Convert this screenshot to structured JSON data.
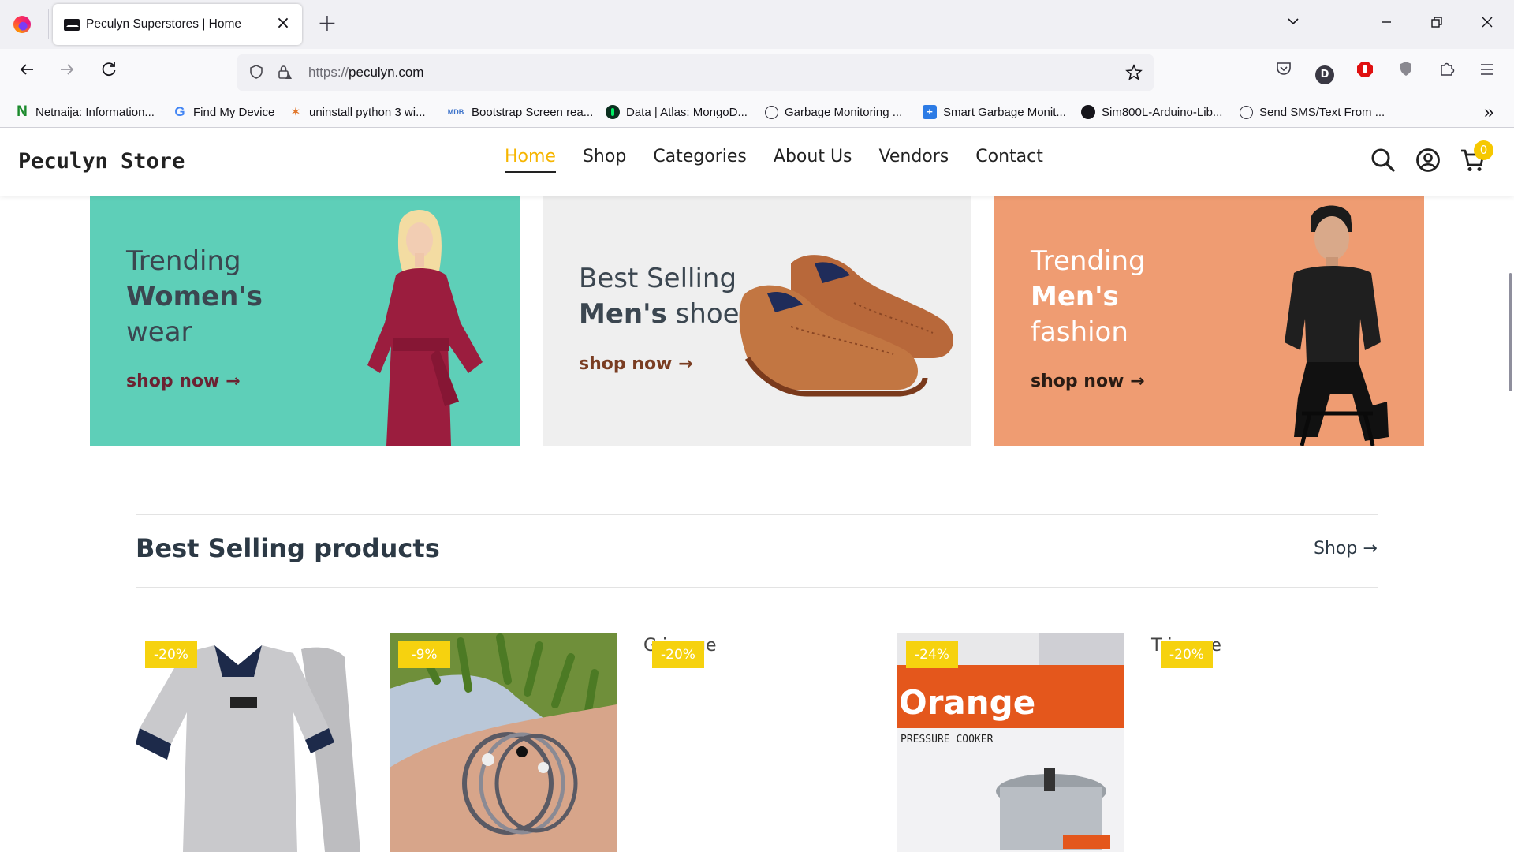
{
  "browser": {
    "tab_title": "Peculyn Superstores | Home",
    "url_scheme": "https://",
    "url_host": "peculyn.com",
    "bookmarks": [
      {
        "label": "Netnaija: Information...",
        "icon": "netnaija-icon"
      },
      {
        "label": "Find My Device",
        "icon": "google-icon"
      },
      {
        "label": "uninstall python 3 wi...",
        "icon": "bookmark-icon"
      },
      {
        "label": "Bootstrap Screen rea...",
        "icon": "mdb-icon"
      },
      {
        "label": "Data | Atlas: MongoD...",
        "icon": "mongodb-icon"
      },
      {
        "label": "Garbage Monitoring ...",
        "icon": "globe-icon"
      },
      {
        "label": "Smart Garbage Monit...",
        "icon": "site-icon"
      },
      {
        "label": "Sim800L-Arduino-Lib...",
        "icon": "github-icon"
      },
      {
        "label": "Send SMS/Text From ...",
        "icon": "globe-icon"
      }
    ],
    "profile_initial": "D"
  },
  "site": {
    "brand": "Peculyn Store",
    "menu": [
      "Home",
      "Shop",
      "Categories",
      "About Us",
      "Vendors",
      "Contact"
    ],
    "cart_count": "0"
  },
  "banners": [
    {
      "line1": "Trending",
      "line2": "Women's",
      "line3": "wear",
      "cta": "shop now",
      "bg": "#5ecfb8"
    },
    {
      "line1": "Best Selling",
      "line2_bold": "Men's",
      "line2_rest": " shoe",
      "cta": "shop now",
      "bg": "#efefef"
    },
    {
      "line1": "Trending",
      "line2": "Men's",
      "line3": "fashion",
      "cta": "shop now",
      "bg": "#ef9c72"
    }
  ],
  "section": {
    "title": "Best Selling products",
    "link": "Shop"
  },
  "products": [
    {
      "discount": "-20%",
      "alt": ""
    },
    {
      "discount": "-9%",
      "alt": ""
    },
    {
      "discount": "-20%",
      "alt": "G       image"
    },
    {
      "discount": "-24%",
      "alt": ""
    },
    {
      "discount": "-20%",
      "alt": "T       image"
    }
  ],
  "product_images": {
    "cooker_brand": "Orange",
    "cooker_label": "PRESSURE COOKER"
  },
  "colors": {
    "accent": "#f6b500",
    "badge": "#f6d20f",
    "cta_dark": "#6b2232"
  }
}
